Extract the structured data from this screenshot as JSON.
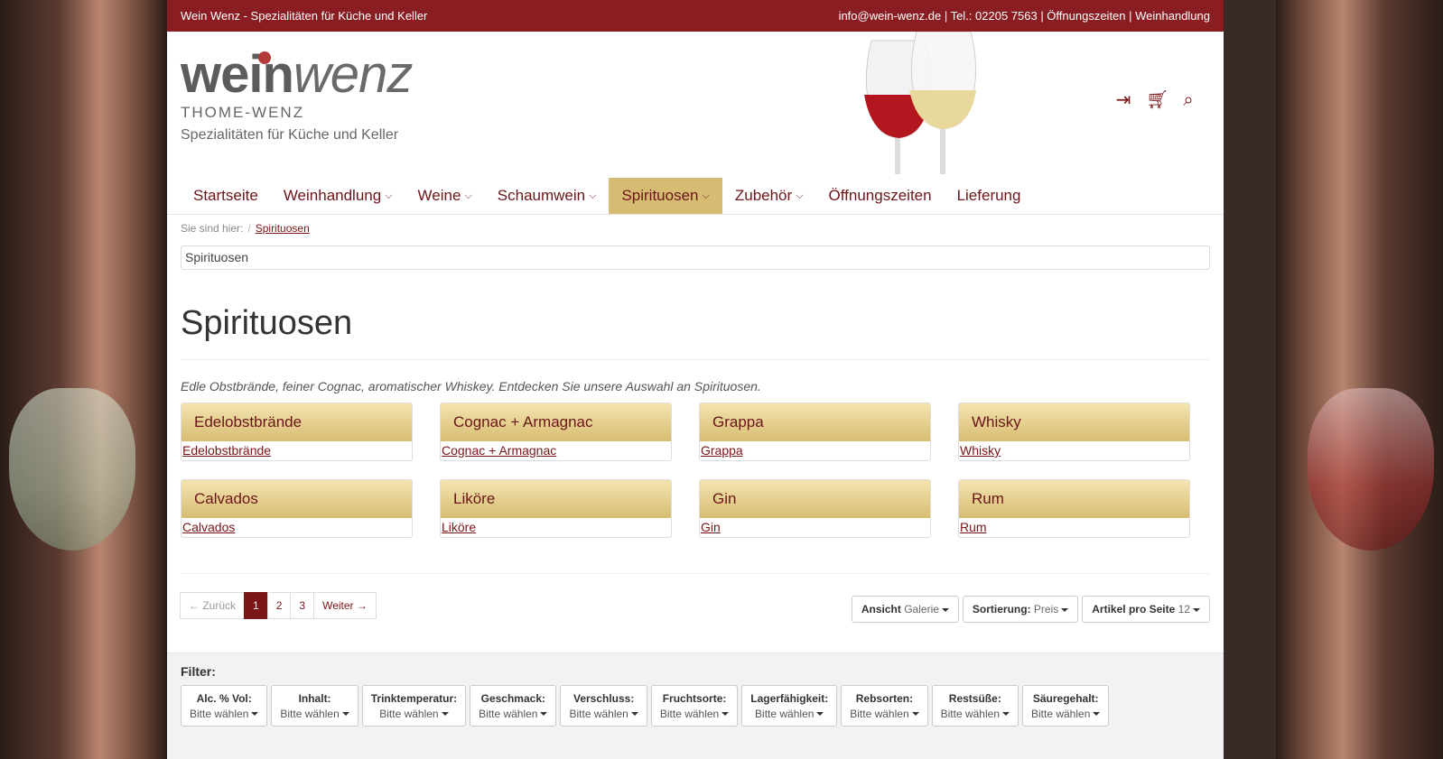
{
  "topbar": {
    "left": "Wein Wenz - Spezialitäten für Küche und Keller",
    "right": "info@wein-wenz.de | Tel.: 02205 7563 | Öffnungszeiten | Weinhandlung"
  },
  "logo": {
    "word1": "wein",
    "word2": "wenz",
    "sub": "THOME-WENZ",
    "tagline": "Spezialitäten für Küche und Keller"
  },
  "header_icons": [
    "sign-in-icon",
    "cart-icon",
    "search-icon"
  ],
  "nav": [
    {
      "label": "Startseite",
      "dropdown": false
    },
    {
      "label": "Weinhandlung",
      "dropdown": true
    },
    {
      "label": "Weine",
      "dropdown": true
    },
    {
      "label": "Schaumwein",
      "dropdown": true
    },
    {
      "label": "Spirituosen",
      "dropdown": true,
      "active": true
    },
    {
      "label": "Zubehör",
      "dropdown": true
    },
    {
      "label": "Öffnungszeiten",
      "dropdown": false
    },
    {
      "label": "Lieferung",
      "dropdown": false
    }
  ],
  "breadcrumb": {
    "prefix": "Sie sind hier:",
    "sep": "/",
    "current": "Spirituosen"
  },
  "banner_alt": "Spirituosen",
  "title": "Spirituosen",
  "intro": "Edle Obstbrände, feiner Cognac, aromatischer Whiskey. Entdecken Sie unsere Auswahl an Spirituosen.",
  "categories": [
    {
      "title": "Edelobstbrände",
      "img_alt": "Edelobstbrände"
    },
    {
      "title": "Cognac + Armagnac",
      "img_alt": "Cognac + Armagnac"
    },
    {
      "title": "Grappa",
      "img_alt": "Grappa"
    },
    {
      "title": "Whisky",
      "img_alt": "Whisky"
    },
    {
      "title": "Calvados",
      "img_alt": "Calvados"
    },
    {
      "title": "Liköre",
      "img_alt": "Liköre"
    },
    {
      "title": "Gin",
      "img_alt": "Gin"
    },
    {
      "title": "Rum",
      "img_alt": "Rum"
    }
  ],
  "pager": {
    "prev": "← Zurück",
    "pages": [
      "1",
      "2",
      "3"
    ],
    "current": "1",
    "next": "Weiter →"
  },
  "view_controls": [
    {
      "label": "Ansicht",
      "value": "Galerie"
    },
    {
      "label": "Sortierung:",
      "value": "Preis"
    },
    {
      "label": "Artikel pro Seite",
      "value": "12"
    }
  ],
  "filter": {
    "title": "Filter:",
    "items": [
      {
        "label": "Alc. % Vol:",
        "value": "Bitte wählen"
      },
      {
        "label": "Inhalt:",
        "value": "Bitte wählen"
      },
      {
        "label": "Trinktemperatur:",
        "value": "Bitte wählen"
      },
      {
        "label": "Geschmack:",
        "value": "Bitte wählen"
      },
      {
        "label": "Verschluss:",
        "value": "Bitte wählen"
      },
      {
        "label": "Fruchtsorte:",
        "value": "Bitte wählen"
      },
      {
        "label": "Lagerfähigkeit:",
        "value": "Bitte wählen"
      },
      {
        "label": "Rebsorten:",
        "value": "Bitte wählen"
      },
      {
        "label": "Restsüße:",
        "value": "Bitte wählen"
      },
      {
        "label": "Säuregehalt:",
        "value": "Bitte wählen"
      }
    ]
  },
  "colors": {
    "brand": "#8a1d22",
    "accent_gold": "#d6bc72",
    "link": "#7a1518"
  }
}
